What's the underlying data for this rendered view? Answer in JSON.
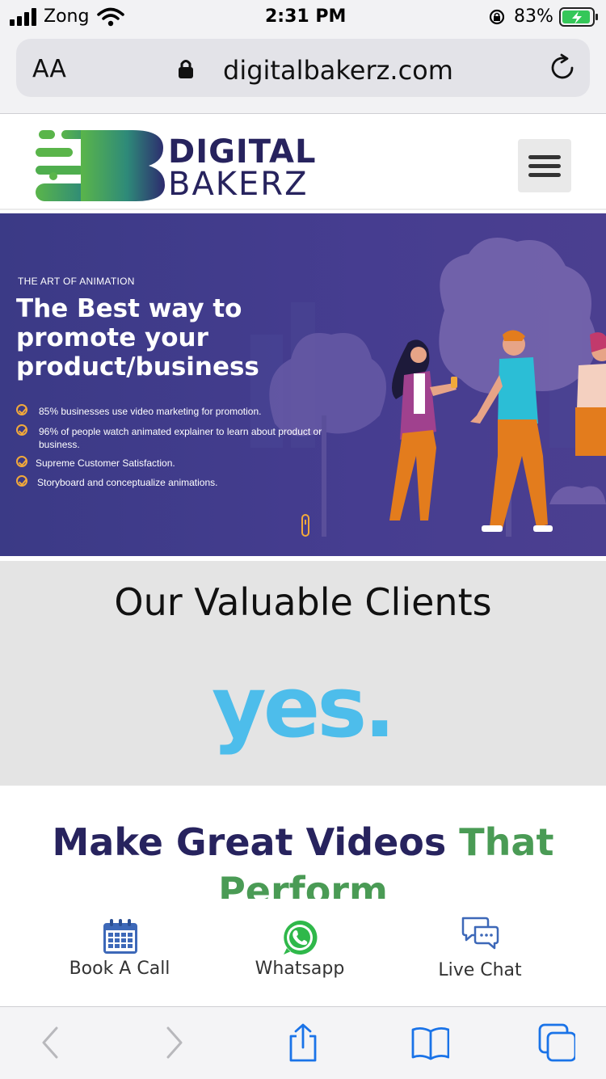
{
  "status": {
    "carrier": "Zong",
    "time": "2:31 PM",
    "battery": "83%"
  },
  "browser": {
    "text_size_label": "AA",
    "url": "digitalbakerz.com"
  },
  "header": {
    "logo_line1": "DIGITAL",
    "logo_line2": "BAKERZ"
  },
  "hero": {
    "kicker": "THE ART OF ANIMATION",
    "title": "The Best way to promote your product/business",
    "points": [
      "85% businesses use video marketing for promotion.",
      "96% of people watch animated explainer to learn about product or business.",
      "Supreme Customer Satisfaction.",
      "Storyboard and conceptualize animations."
    ]
  },
  "clients": {
    "title": "Our Valuable Clients",
    "logo_text": "yes."
  },
  "videos": {
    "title_part1": "Make Great Videos",
    "title_part2": "That Perform"
  },
  "actions": {
    "book": "Book A Call",
    "whatsapp": "Whatsapp",
    "chat": "Live Chat"
  },
  "colors": {
    "brand_navy": "#27235e",
    "brand_green": "#4a9b55",
    "hero_bg": "#3f3b89",
    "check": "#f2a93b",
    "client_blue": "#4dbdeb"
  }
}
